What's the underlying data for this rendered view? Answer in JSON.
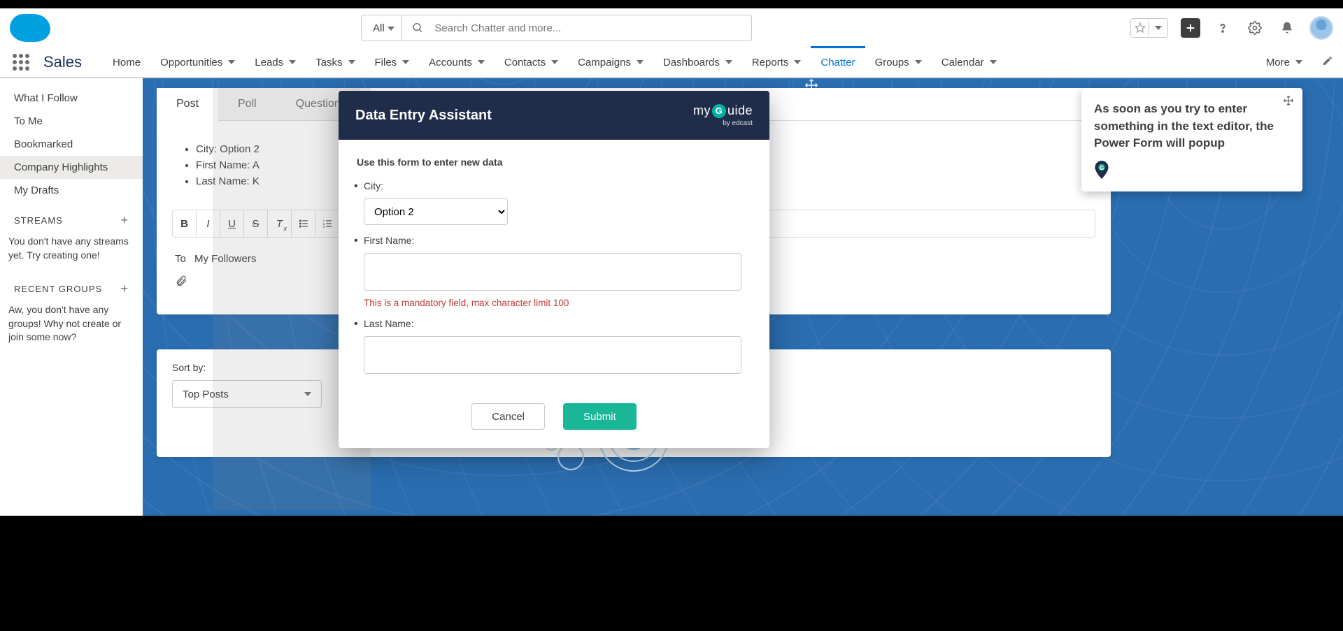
{
  "header": {
    "search_scope": "All",
    "search_placeholder": "Search Chatter and more..."
  },
  "nav": {
    "app_name": "Sales",
    "items": [
      {
        "label": "Home",
        "dropdown": false
      },
      {
        "label": "Opportunities",
        "dropdown": true
      },
      {
        "label": "Leads",
        "dropdown": true
      },
      {
        "label": "Tasks",
        "dropdown": true
      },
      {
        "label": "Files",
        "dropdown": true
      },
      {
        "label": "Accounts",
        "dropdown": true
      },
      {
        "label": "Contacts",
        "dropdown": true
      },
      {
        "label": "Campaigns",
        "dropdown": true
      },
      {
        "label": "Dashboards",
        "dropdown": true
      },
      {
        "label": "Reports",
        "dropdown": true
      },
      {
        "label": "Chatter",
        "dropdown": false,
        "active": true
      },
      {
        "label": "Groups",
        "dropdown": true
      },
      {
        "label": "Calendar",
        "dropdown": true
      }
    ],
    "more_label": "More"
  },
  "sidebar": {
    "items": [
      {
        "label": "What I Follow"
      },
      {
        "label": "To Me"
      },
      {
        "label": "Bookmarked"
      },
      {
        "label": "Company Highlights",
        "selected": true
      },
      {
        "label": "My Drafts"
      }
    ],
    "streams_heading": "STREAMS",
    "streams_empty": "You don't have any streams yet. Try creating one!",
    "groups_heading": "RECENT GROUPS",
    "groups_empty": "Aw, you don't have any groups! Why not create or join some now?"
  },
  "composer": {
    "tabs": [
      {
        "label": "Post",
        "active": true
      },
      {
        "label": "Poll"
      },
      {
        "label": "Question"
      }
    ],
    "bullets": [
      "City:  Option 2",
      "First Name: A",
      "Last Name: K"
    ],
    "to_label": "To",
    "to_value": "My Followers",
    "sort_label": "Sort by:",
    "sort_value": "Top Posts"
  },
  "modal": {
    "title": "Data Entry Assistant",
    "brand": "myGuide",
    "brand_sub": "by edcast",
    "intro": "Use this form to enter new data",
    "fields": {
      "city_label": "City:",
      "city_value": "Option 2",
      "first_label": "First Name:",
      "first_error": "This is a mandatory field, max character limit 100",
      "last_label": "Last Name:"
    },
    "cancel": "Cancel",
    "submit": "Submit"
  },
  "tip": {
    "text": "As soon as you try to enter something in the text editor, the Power Form will popup"
  }
}
